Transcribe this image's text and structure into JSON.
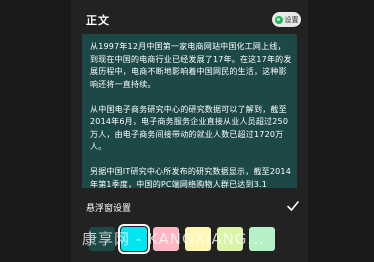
{
  "header": {
    "title": "正文",
    "settings_label": "设置"
  },
  "body_text": {
    "paragraphs": [
      "从1997年12月中国第一家电商网站中国化工网上线，到现在中国的电商行业已经发展了17年。在这17年的发展历程中，电商不断地影响着中国网民的生活，这种影响还将一直持续。",
      "从中国电子商务研究中心的研究数据可以了解到，截至2014年6月，电子商务服务企业直接从业人员超过250万人，由电子商务间接带动的就业人数已超过1720万人。",
      "另据中国IT研究中心所发布的研究数据显示，截至2014年第1季度，中国的PC端网络购物人群已达到3.1"
    ],
    "background_color": "#1d4848"
  },
  "float_settings": {
    "title": "悬浮窗设置",
    "confirm_icon": "check-icon"
  },
  "swatches": [
    {
      "color": "#1d4848",
      "selected": false
    },
    {
      "color": "#00e5ee",
      "selected": true
    },
    {
      "color": "#ffb6c1",
      "selected": false
    },
    {
      "color": "#fff6b3",
      "selected": false
    },
    {
      "color": "#d9f5a8",
      "selected": false
    },
    {
      "color": "#b6f0c8",
      "selected": false
    }
  ],
  "watermark": "康享网 - KANGXIANG..."
}
